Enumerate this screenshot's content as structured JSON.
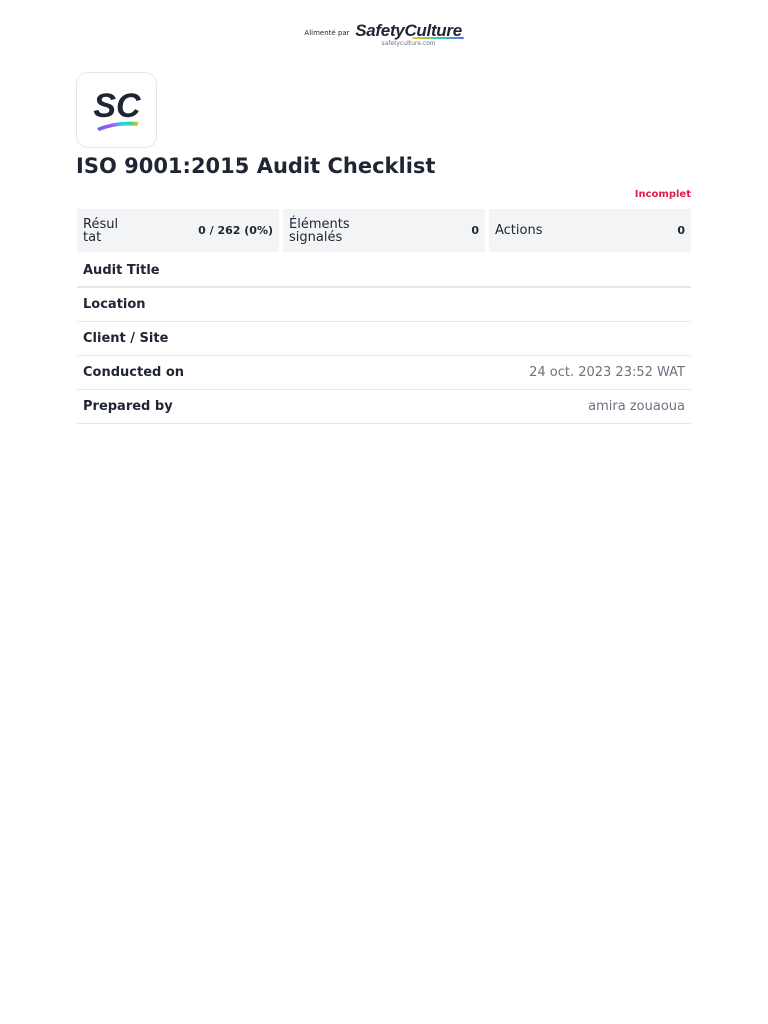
{
  "header": {
    "powered_by_prefix": "Alimenté par",
    "brand": "SafetyCulture",
    "brand_url": "safetyculture.com"
  },
  "logo": {
    "text": "SC",
    "icon": "safetyculture-logo"
  },
  "document": {
    "title": "ISO 9001:2015 Audit Checklist",
    "status": "Incomplet"
  },
  "stats": [
    {
      "label": "Résultat",
      "value": "0 / 262 (0%)"
    },
    {
      "label": "Éléments signalés",
      "value": "0"
    },
    {
      "label": "Actions",
      "value": "0"
    }
  ],
  "info_rows": [
    {
      "label": "Audit Title",
      "value": ""
    },
    {
      "label": "Location",
      "value": ""
    },
    {
      "label": "Client / Site",
      "value": ""
    },
    {
      "label": "Conducted on",
      "value": "24 oct. 2023 23:52 WAT"
    },
    {
      "label": "Prepared by",
      "value": "amira zouaoua"
    }
  ],
  "colors": {
    "status": "#e11d48",
    "text": "#1f2533",
    "muted": "#6b7280",
    "panel": "#f3f4f6"
  }
}
